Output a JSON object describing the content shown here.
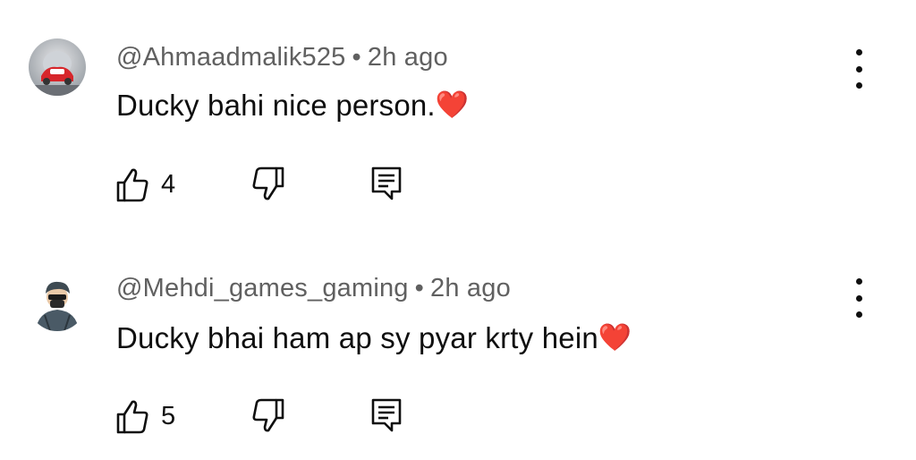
{
  "comments": [
    {
      "author": "@Ahmaadmalik525",
      "separator": "•",
      "time": "2h ago",
      "text": "Ducky bahi nice person.",
      "emoji": "❤️",
      "likes": "4",
      "avatar": "avatar-red-car-icon"
    },
    {
      "author": "@Mehdi_games_gaming",
      "separator": "•",
      "time": "2h ago",
      "text": "Ducky bhai ham ap sy pyar krty hein",
      "emoji": "❤️",
      "likes": "5",
      "avatar": "avatar-masked-person-icon"
    }
  ],
  "colors": {
    "text_primary": "#0f0f0f",
    "text_secondary": "#606060",
    "heart": "#e0245e"
  }
}
